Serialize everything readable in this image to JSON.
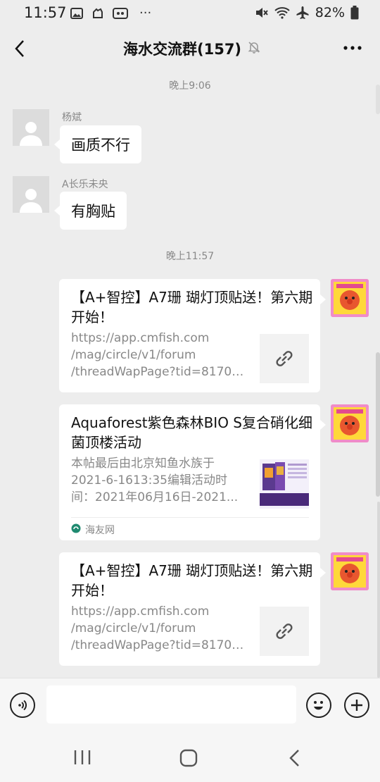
{
  "status_bar": {
    "time": "11:57",
    "more": "···",
    "battery": "82%"
  },
  "header": {
    "title": "海水交流群(157)"
  },
  "chat": {
    "timestamps": [
      "晚上9:06",
      "晚上11:57"
    ],
    "messages": [
      {
        "sender": "杨斌",
        "text": "画质不行"
      },
      {
        "sender": "A长乐未央",
        "text": "有胸贴"
      }
    ],
    "cards": [
      {
        "title": "【A+智控】A7珊 瑚灯顶贴送！第六期开始！",
        "desc_lines": [
          "https://app.cmfish.com",
          "/mag/circle/v1/forum",
          "/threadWapPage?tid=81709..."
        ]
      },
      {
        "title": "Aquaforest紫色森林BIO S复合硝化细菌顶楼活动",
        "desc_lines": [
          "本帖最后由北京知鱼水族于",
          "2021-6-1613:35编辑活动时",
          "间：2021年06月16日-2021..."
        ],
        "source": "海友网"
      },
      {
        "title": "【A+智控】A7珊 瑚灯顶贴送！第六期开始！",
        "desc_lines": [
          "https://app.cmfish.com",
          "/mag/circle/v1/forum",
          "/threadWapPage?tid=81709..."
        ]
      }
    ]
  },
  "input": {
    "value": "",
    "placeholder": ""
  },
  "colors": {
    "background": "#ededed",
    "bubble": "#ffffff",
    "avatar_pink": "#f39bd2"
  },
  "icons": [
    "back-arrow-icon",
    "more-icon",
    "mute-bell-icon",
    "voice-icon",
    "emoji-icon",
    "plus-icon",
    "link-icon",
    "recent-apps-icon",
    "home-icon",
    "nav-back-icon"
  ]
}
